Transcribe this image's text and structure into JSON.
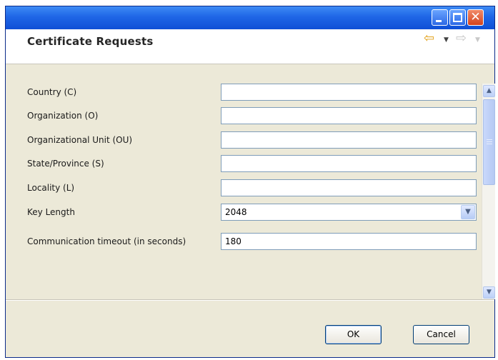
{
  "window": {
    "title": "",
    "controls": {
      "minimize": "minimize-icon",
      "maximize": "maximize-icon",
      "close": "close-icon"
    }
  },
  "header": {
    "title": "Certificate Requests",
    "nav": {
      "back": "back-arrow-icon",
      "forward": "forward-arrow-icon"
    }
  },
  "form": {
    "rows": [
      {
        "label": "Country (C)",
        "value": ""
      },
      {
        "label": "Organization (O)",
        "value": ""
      },
      {
        "label": "Organizational Unit (OU)",
        "value": ""
      },
      {
        "label": "State/Province (S)",
        "value": ""
      },
      {
        "label": "Locality (L)",
        "value": ""
      },
      {
        "label": "Key Length",
        "value": "2048"
      },
      {
        "label": "Communication timeout (in seconds)",
        "value": "180"
      }
    ]
  },
  "buttons": {
    "ok": "OK",
    "cancel": "Cancel"
  },
  "colors": {
    "titlebar": "#1f66e6",
    "close": "#d5431d",
    "dialog_bg": "#ece9d8",
    "field_border": "#7f9db9"
  }
}
